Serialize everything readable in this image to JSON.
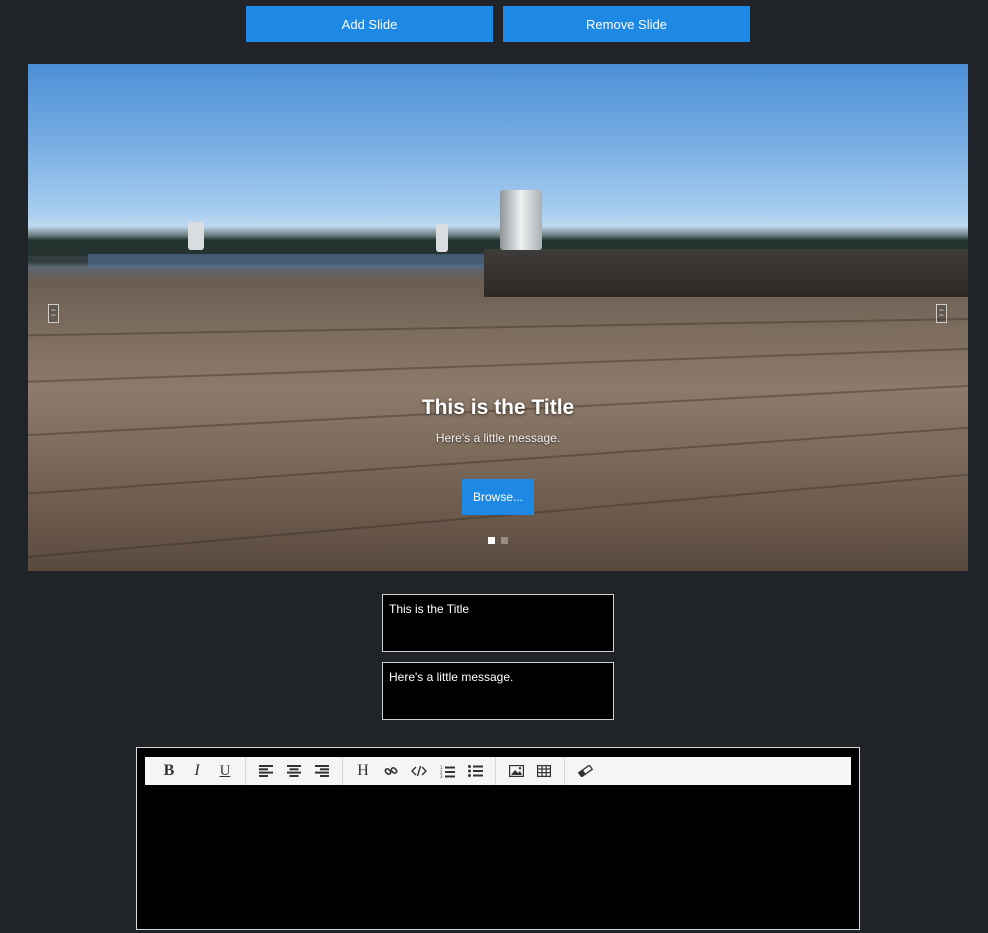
{
  "controls": {
    "add_slide": "Add Slide",
    "remove_slide": "Remove Slide"
  },
  "slider": {
    "title": "This is the Title",
    "message": "Here's a little message.",
    "button": "Browse...",
    "slide_count": 2,
    "active_slide": 1
  },
  "form": {
    "title_value": "This is the Title",
    "message_value": "Here's a little message."
  },
  "editor": {
    "toolbar": {
      "bold": "B",
      "italic": "I",
      "underline": "U",
      "heading": "H"
    },
    "icons": [
      "bold-icon",
      "italic-icon",
      "underline-icon",
      "align-left-icon",
      "align-center-icon",
      "align-right-icon",
      "heading-icon",
      "link-icon",
      "code-icon",
      "ordered-list-icon",
      "unordered-list-icon",
      "image-icon",
      "table-icon",
      "eraser-icon"
    ]
  },
  "colors": {
    "accent": "#1e88e5",
    "background": "#202327"
  }
}
